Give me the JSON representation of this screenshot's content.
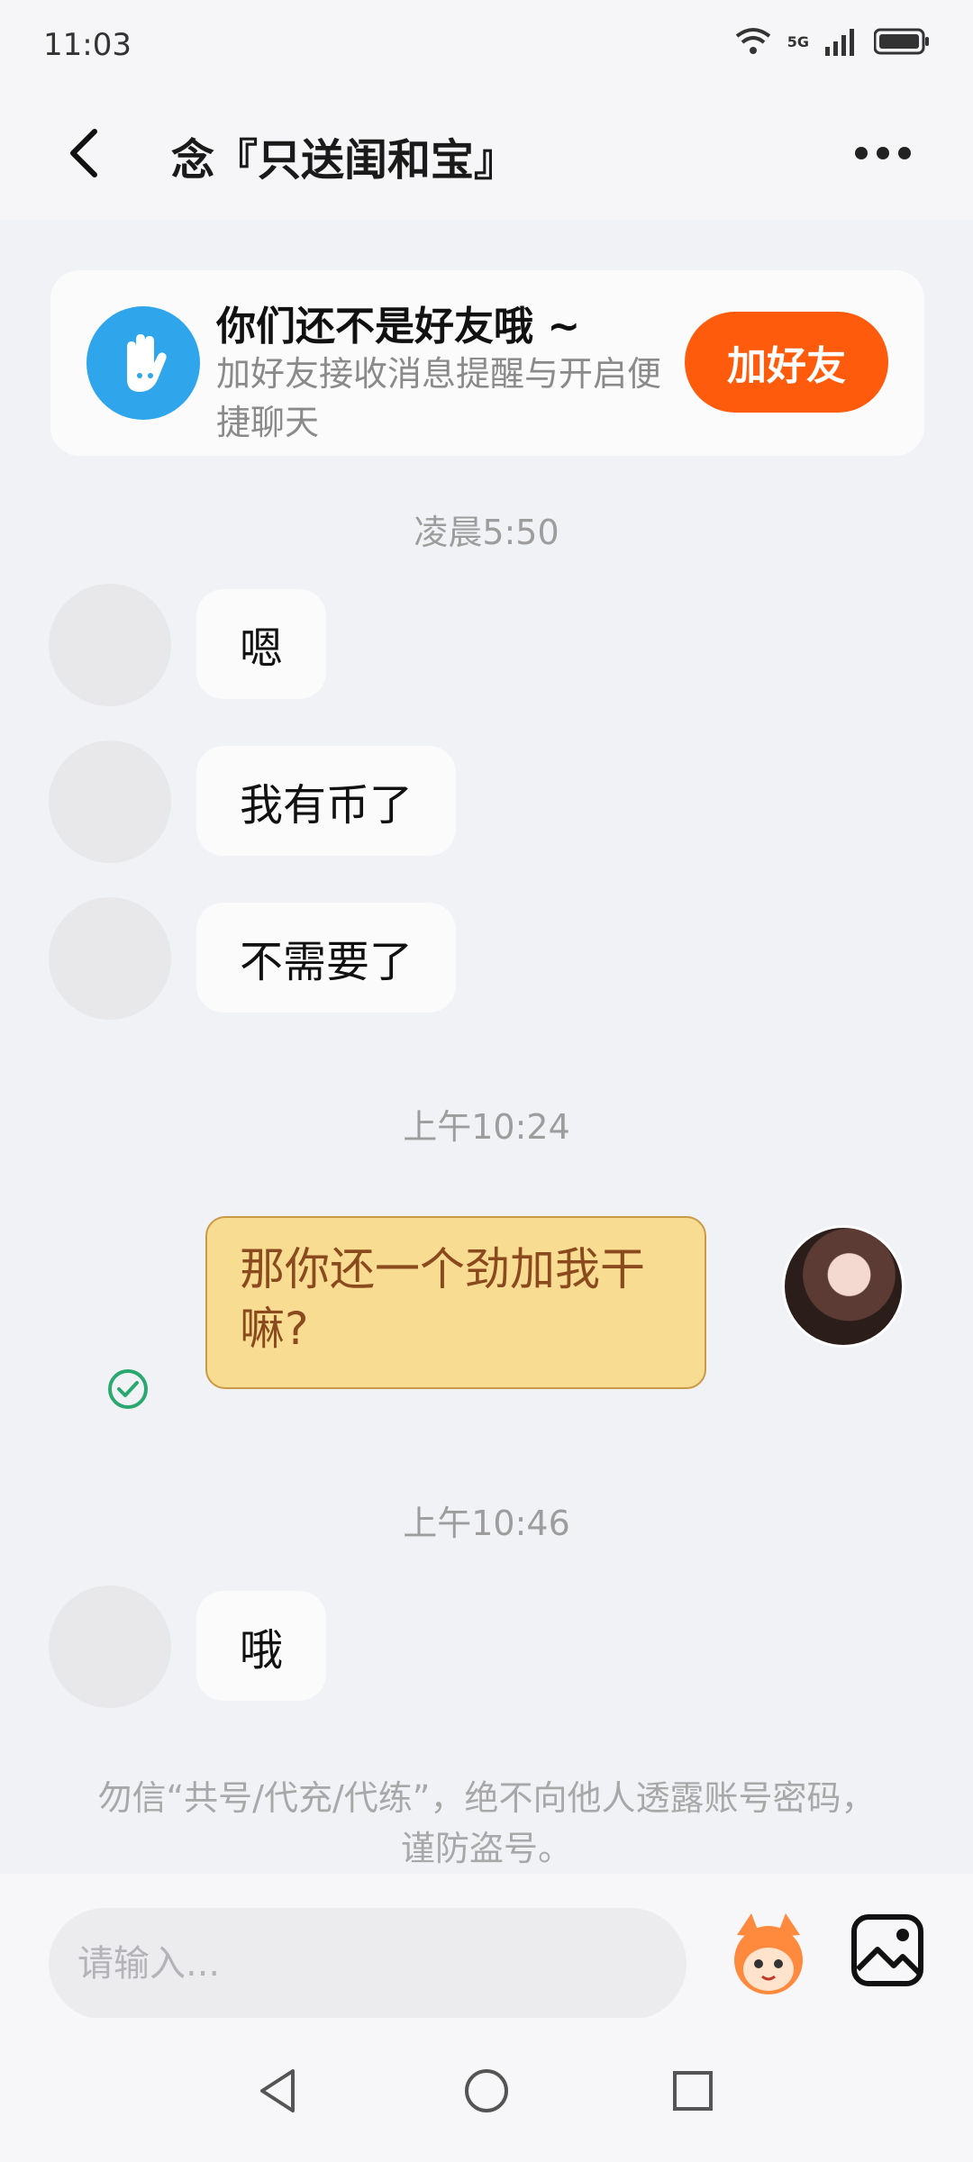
{
  "status": {
    "time": "11:03",
    "network": "5G"
  },
  "header": {
    "title": "念『只送闺和宝』"
  },
  "friend_card": {
    "title": "你们还不是好友哦 ~",
    "desc": "加好友接收消息提醒与开启便捷聊天",
    "button": "加好友"
  },
  "messages": {
    "ts1": "凌晨5:50",
    "in1": "嗯",
    "in2": "我有币了",
    "in3": "不需要了",
    "ts2": "上午10:24",
    "out1": "那你还一个劲加我干嘛?",
    "ts3": "上午10:46",
    "in4": "哦"
  },
  "notice": "勿信“共号/代充/代练”，绝不向他人透露账号密码，谨防盗号。",
  "input": {
    "placeholder": "请输入..."
  },
  "colors": {
    "accent": "#ff5b0d",
    "friend_icon": "#2fa6ec",
    "sent_bubble": "#f8dc92",
    "sent_check": "#2aa86f"
  }
}
